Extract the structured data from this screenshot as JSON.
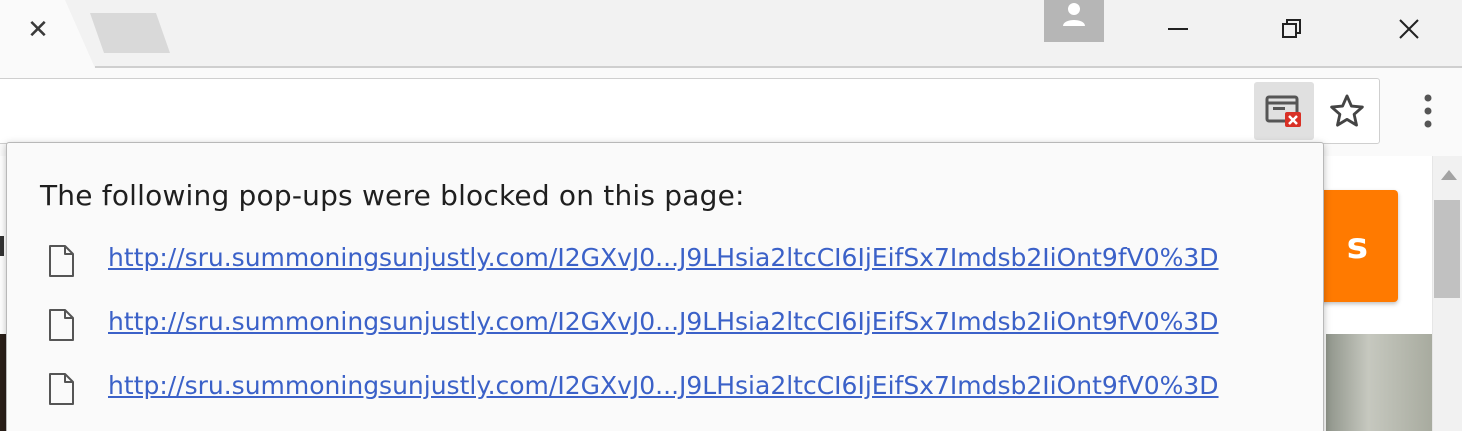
{
  "window": {
    "close_tab_glyph": "✕",
    "colors": {
      "tabstrip": "#f2f2f2",
      "toolbar": "#fafafa",
      "accent_orange": "#ff7a00",
      "link": "#3b61c8"
    }
  },
  "toolbar": {
    "icons": [
      "popup-blocked-icon",
      "star-icon",
      "more-vert-icon"
    ]
  },
  "page": {
    "orange_button_text": "s"
  },
  "popup_bubble": {
    "title": "The following pop-ups were blocked on this page:",
    "items": [
      {
        "url": "http://sru.summoningsunjustly.com/I2GXvJ0...J9LHsia2ltcCI6IjEifSx7Imdsb2IiOnt9fV0%3D"
      },
      {
        "url": "http://sru.summoningsunjustly.com/I2GXvJ0...J9LHsia2ltcCI6IjEifSx7Imdsb2IiOnt9fV0%3D"
      },
      {
        "url": "http://sru.summoningsunjustly.com/I2GXvJ0...J9LHsia2ltcCI6IjEifSx7Imdsb2IiOnt9fV0%3D"
      }
    ]
  }
}
